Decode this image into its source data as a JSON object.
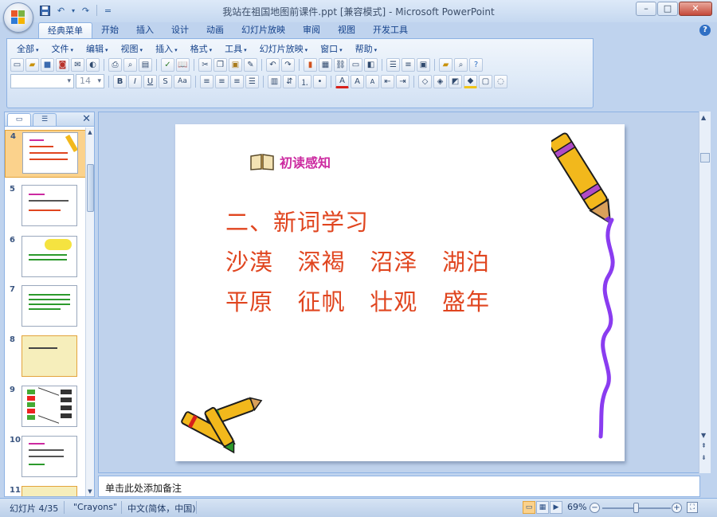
{
  "window": {
    "title": "我站在祖国地图前课件.ppt [兼容模式] - Microsoft PowerPoint",
    "minimize": "–",
    "maximize": "□",
    "close": "✕"
  },
  "qat": {
    "save_icon": "save-icon",
    "undo_icon": "undo-icon",
    "redo_icon": "redo-icon",
    "customize": "="
  },
  "ribbon_tabs": [
    "经典菜单",
    "开始",
    "插入",
    "设计",
    "动画",
    "幻灯片放映",
    "审阅",
    "视图",
    "开发工具"
  ],
  "menu": [
    "全部",
    "文件",
    "编辑",
    "视图",
    "插入",
    "格式",
    "工具",
    "幻灯片放映",
    "窗口",
    "帮助"
  ],
  "font_box": {
    "font": "",
    "size": "14"
  },
  "format_buttons": [
    "B",
    "I",
    "U",
    "S",
    "Aa"
  ],
  "thumbnails": [
    {
      "num": "4",
      "selected": true
    },
    {
      "num": "5",
      "selected": false
    },
    {
      "num": "6",
      "selected": false
    },
    {
      "num": "7",
      "selected": false
    },
    {
      "num": "8",
      "selected": false
    },
    {
      "num": "9",
      "selected": false
    },
    {
      "num": "10",
      "selected": false
    },
    {
      "num": "11",
      "selected": false
    }
  ],
  "slide": {
    "heading": "初读感知",
    "lines": [
      "二、新词学习",
      "沙漠   深褐   沼泽   湖泊",
      "平原   征帆   壮观   盛年"
    ]
  },
  "notes_placeholder": "单击此处添加备注",
  "status": {
    "slide_info": "幻灯片 4/35",
    "theme": "\"Crayons\"",
    "language": "中文(简体，中国)",
    "zoom": "69%",
    "zoom_level": 0.5
  },
  "colors": {
    "accent": "#15428b",
    "heading": "#cc2aa0",
    "slide_text": "#e0451f",
    "selection": "#fbd28c"
  }
}
